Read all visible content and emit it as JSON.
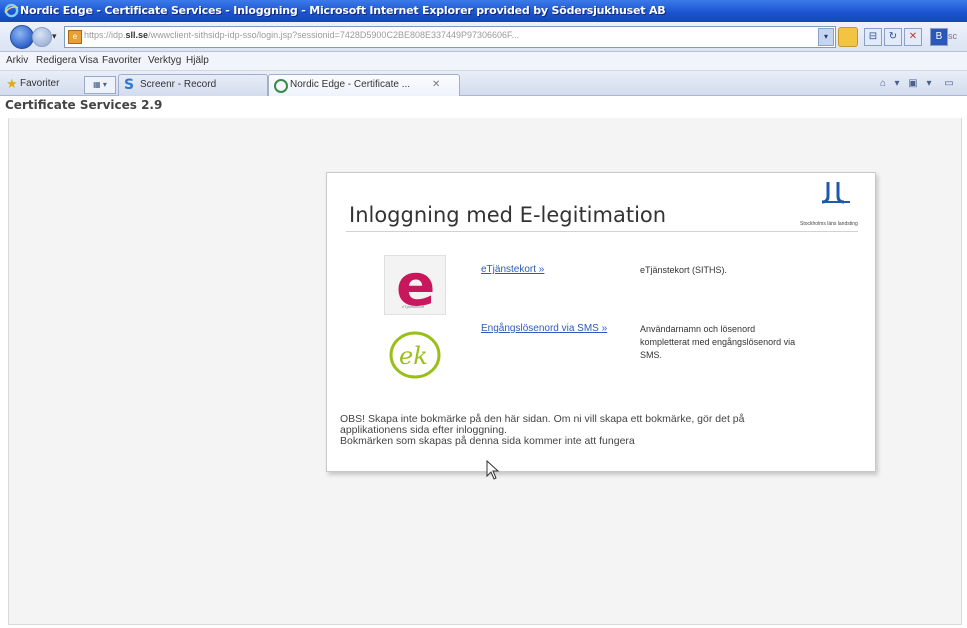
{
  "window": {
    "title": "Nordic Edge - Certificate Services - Inloggning - Microsoft Internet Explorer provided by Södersjukhuset AB"
  },
  "address": {
    "url_prefix": "https://idp.",
    "url_domain": "sll.se",
    "url_rest": "/wwwclient-sithsidp-idp-sso/login.jsp?sessionid=7428D5900C2BE808E337449P97306606F..."
  },
  "menu": {
    "items": [
      "Arkiv",
      "Redigera",
      "Visa",
      "Favoriter",
      "Verktyg",
      "Hjälp"
    ]
  },
  "tabs": {
    "favorites_label": "Favoriter",
    "items": [
      {
        "label": "Screenr - Record"
      },
      {
        "label": "Nordic Edge - Certificate ..."
      }
    ]
  },
  "app": {
    "title": "Certificate Services 2.9"
  },
  "login": {
    "heading": "Inloggning med E-legitimation",
    "org_name": "Stockholms läns landsting",
    "options": [
      {
        "link": "eTjänstekort »",
        "description": "eTjänstekort (SITHS)."
      },
      {
        "link": "Engångslösenord via SMS »",
        "description": "Användarnamn och lösenord kompletterat med engångslösenord via SMS."
      }
    ],
    "notice_lines": [
      "OBS! Skapa inte bokmärke på den här sidan. Om ni vill skapa ett bokmärke, gör det på",
      "applikationens sida efter inloggning.",
      "Bokmärken som skapas på denna sida kommer inte att fungera"
    ],
    "e_logo_caption": "eTjänstekort"
  },
  "colors": {
    "titlebar": "#1a52cf",
    "link": "#2b5bbf",
    "etjanstekort_brand": "#c8175d",
    "ek_brand": "#9bbf1a"
  }
}
